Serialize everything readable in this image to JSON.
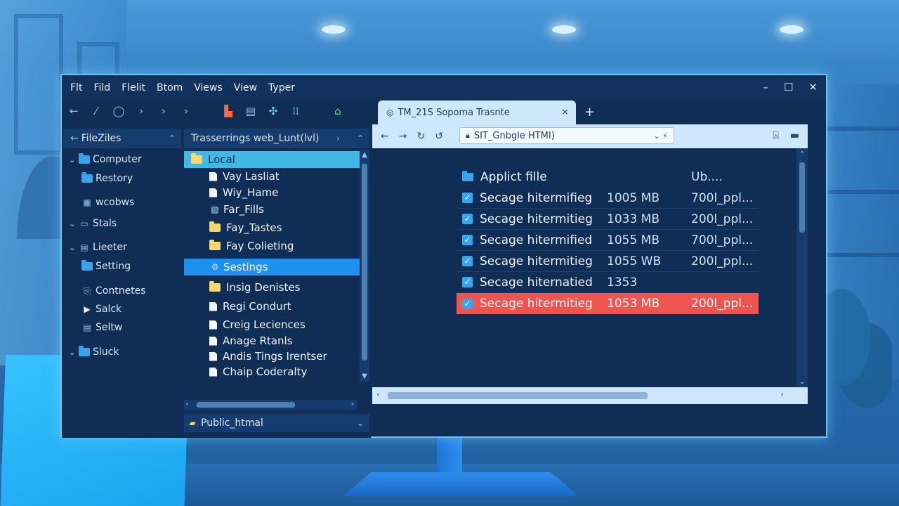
{
  "menu": [
    "Flt",
    "Fild",
    "Flelit",
    "Btom",
    "Views",
    "View",
    "Typer"
  ],
  "window_controls": {
    "minimize": "–",
    "maximize": "☐",
    "close": "✕"
  },
  "site_tree": {
    "header": "FileZiles",
    "items": [
      {
        "label": "Computer",
        "level": 0,
        "expanded": true,
        "icon": "folder-icon"
      },
      {
        "label": "Restory",
        "level": 1,
        "icon": "folder-icon"
      },
      {
        "label": "wcobws",
        "level": 1,
        "icon": "windows-folder-icon"
      },
      {
        "label": "Stals",
        "level": 0,
        "expanded": true,
        "icon": "monitor-icon"
      },
      {
        "label": "Lieeter",
        "level": 0,
        "expanded": true,
        "icon": "document-icon"
      },
      {
        "label": "Setting",
        "level": 1,
        "icon": "folder-icon"
      },
      {
        "label": "Contnetes",
        "level": 1,
        "icon": "link-icon"
      },
      {
        "label": "Salck",
        "level": 1,
        "icon": "play-icon"
      },
      {
        "label": "Seltw",
        "level": 1,
        "icon": "document-icon"
      },
      {
        "label": "Sluck",
        "level": 0,
        "expanded": true,
        "icon": "folder-icon"
      }
    ]
  },
  "remote_path": "Trasserrings web_Lunt(lvl)",
  "file_list": {
    "header": "Local",
    "items": [
      {
        "label": "Vay Lasliat",
        "icon": "document-icon"
      },
      {
        "label": "Wiy_Hame",
        "icon": "document-icon"
      },
      {
        "label": "Far_Fills",
        "icon": "image-icon"
      },
      {
        "label": "Fay_Tastes",
        "icon": "folder-icon"
      },
      {
        "label": "Fay Colieting",
        "icon": "folder-icon"
      },
      {
        "label": "Sestings",
        "icon": "settings-icon",
        "selected": true
      },
      {
        "label": "Insig Denistes",
        "icon": "folder-icon"
      },
      {
        "label": "Regi Condurt",
        "icon": "document-icon"
      },
      {
        "label": "Creig Leciences",
        "icon": "document-icon"
      },
      {
        "label": "Anage Rtanls",
        "icon": "document-icon"
      },
      {
        "label": "Andis Tings Irentser",
        "icon": "document-icon"
      },
      {
        "label": "Chaip Coderalty",
        "icon": "document-icon"
      }
    ]
  },
  "status_bar": "Public_htmal",
  "browser": {
    "tab_title": "TM_21S Sopoma Trasnte",
    "tab_close": "✕",
    "new_tab": "+",
    "address": "SIT_Gnbgle HTMI)",
    "header_row": {
      "name": "Applict fille",
      "col3": "Ub...."
    },
    "rows": [
      {
        "name": "Secage hitermifieg",
        "size": "1005 MB",
        "col3": "700l_ppl...",
        "checked": true,
        "highlight": false
      },
      {
        "name": "Secage hitermitieg",
        "size": "1033 MB",
        "col3": "200l_ppl...",
        "checked": true,
        "highlight": false
      },
      {
        "name": "Secage hitermified",
        "size": "1055 MB",
        "col3": "700l_ppl...",
        "checked": true,
        "highlight": false
      },
      {
        "name": "Secage hitermitieg",
        "size": "1055 WB",
        "col3": "200l_ppl...",
        "checked": true,
        "highlight": false
      },
      {
        "name": "Secage hiternatied",
        "size": "1353",
        "col3": "",
        "checked": true,
        "highlight": false
      },
      {
        "name": "Secage hitermitieg",
        "size": "1053 MB",
        "col3": "200l_ppl...",
        "checked": true,
        "highlight": true
      }
    ]
  },
  "colors": {
    "highlight_row": "#ee5550",
    "selected_row": "#1f8ff0",
    "local_header": "#41b8e6"
  }
}
